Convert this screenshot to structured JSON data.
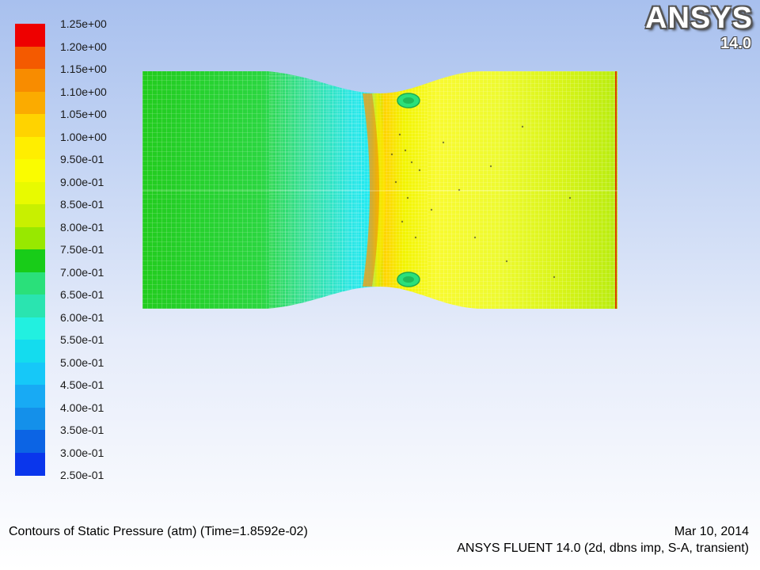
{
  "colorbar": {
    "labels": [
      "1.25e+00",
      "1.20e+00",
      "1.15e+00",
      "1.10e+00",
      "1.05e+00",
      "1.00e+00",
      "9.50e-01",
      "9.00e-01",
      "8.50e-01",
      "8.00e-01",
      "7.50e-01",
      "7.00e-01",
      "6.50e-01",
      "6.00e-01",
      "5.50e-01",
      "5.00e-01",
      "4.50e-01",
      "4.00e-01",
      "3.50e-01",
      "3.00e-01",
      "2.50e-01"
    ],
    "colors": [
      "#ee0000",
      "#f45a00",
      "#f88c00",
      "#fbab00",
      "#ffd300",
      "#ffee00",
      "#fafc00",
      "#e8fa00",
      "#c8f000",
      "#98e800",
      "#18cc18",
      "#2ae07a",
      "#2ae4b0",
      "#22f0e0",
      "#14dcee",
      "#16c8f8",
      "#18aaf4",
      "#1490ea",
      "#0c64e4",
      "#0a36ec"
    ]
  },
  "logo": {
    "brand": "ANSYS",
    "version": "14.0"
  },
  "footer": {
    "title": "Contours of Static Pressure (atm)  (Time=1.8592e-02)",
    "date": "Mar 10, 2014",
    "solver": "ANSYS FLUENT 14.0 (2d, dbns imp, S-A, transient)"
  }
}
